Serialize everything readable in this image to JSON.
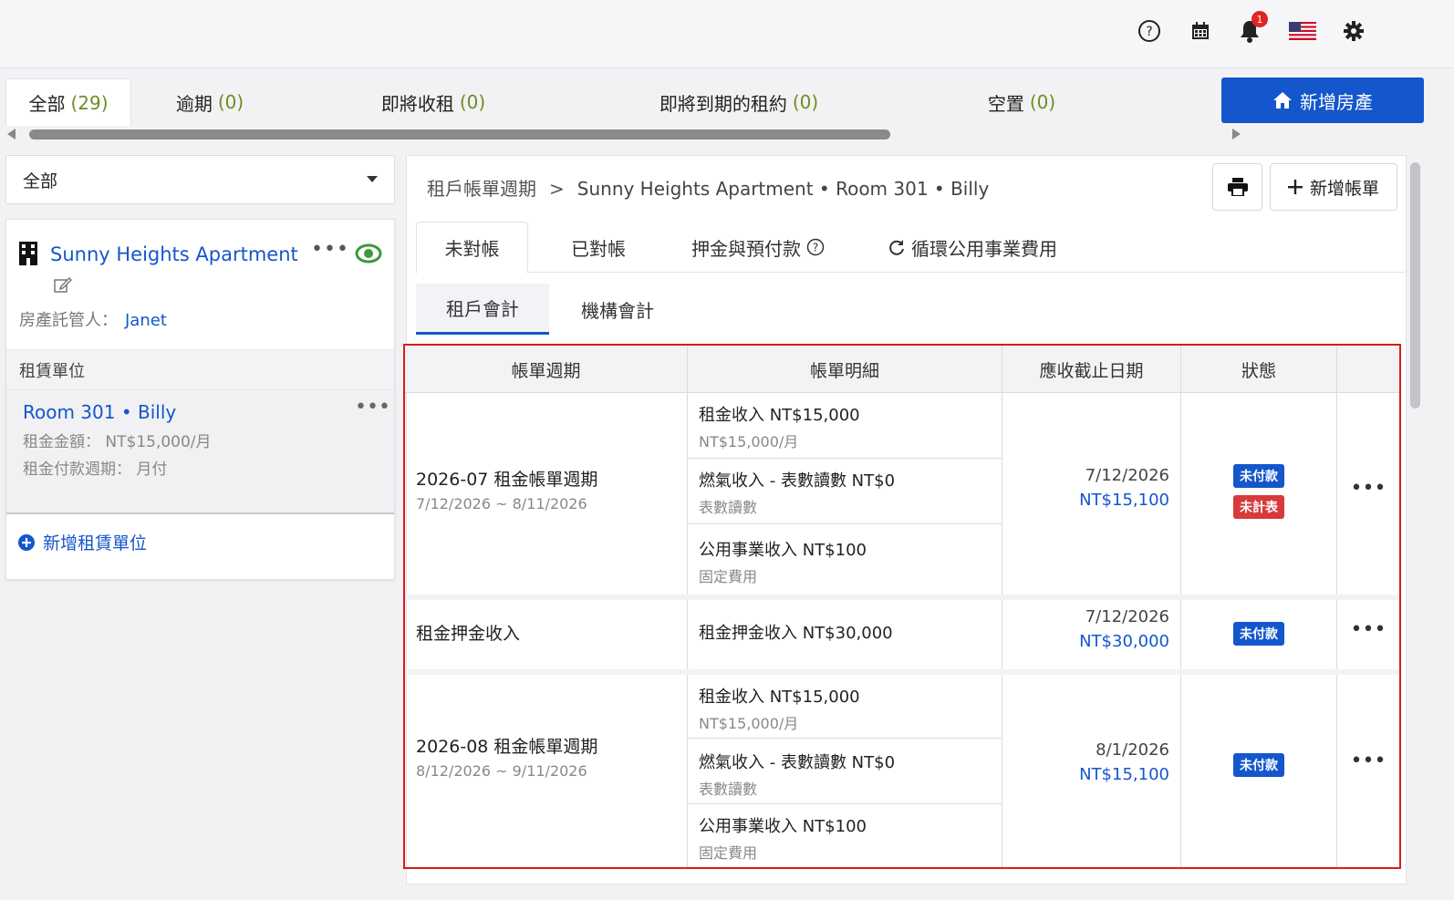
{
  "topbar": {
    "icons": [
      "help-icon",
      "calendar-icon",
      "bell-icon",
      "us-flag-icon",
      "gear-icon"
    ],
    "notification_count": "1"
  },
  "filter_tabs": [
    {
      "label": "全部",
      "count": "(29)"
    },
    {
      "label": "逾期",
      "count": "(0)"
    },
    {
      "label": "即將收租",
      "count": "(0)"
    },
    {
      "label": "即將到期的租約",
      "count": "(0)"
    },
    {
      "label": "空置",
      "count": "(0)"
    }
  ],
  "add_property_label": "新增房產",
  "sidebar": {
    "select_value": "全部",
    "property": {
      "name": "Sunny Heights Apartment",
      "more": "•••",
      "manager_label": "房產託管人：",
      "manager_name": "Janet"
    },
    "units_header": "租賃單位",
    "unit": {
      "title": "Room 301 • Billy",
      "more": "•••",
      "rent_line": "租金金額： NT$15,000/月",
      "cycle_line": "租金付款週期： 月付"
    },
    "add_unit_label": "新增租賃單位"
  },
  "main": {
    "breadcrumb_root": "租戶帳單週期",
    "breadcrumb_sep": ">",
    "breadcrumb_current": "Sunny Heights Apartment • Room 301 • Billy",
    "add_bill_label": "新增帳單",
    "tabs": [
      {
        "label": "未對帳"
      },
      {
        "label": "已對帳"
      },
      {
        "label": "押金與預付款"
      },
      {
        "label": "循環公用事業費用"
      }
    ],
    "subtabs": [
      {
        "label": "租戶會計"
      },
      {
        "label": "機構會計"
      }
    ],
    "table": {
      "headers": [
        "帳單週期",
        "帳單明細",
        "應收截止日期",
        "狀態",
        ""
      ],
      "groups": [
        {
          "period_title": "2026-07 租金帳單週期",
          "period_range": "7/12/2026 ~ 8/11/2026",
          "details": [
            {
              "line1": "租金收入  NT$15,000",
              "line2": "NT$15,000/月"
            },
            {
              "line1": "燃氣收入 - 表數讀數  NT$0",
              "line2": "表數讀數"
            },
            {
              "line1": "公用事業收入  NT$100",
              "line2": "固定費用"
            }
          ],
          "due_date": "7/12/2026",
          "amount": "NT$15,100",
          "statuses": [
            {
              "label": "未付款",
              "color": "blue"
            },
            {
              "label": "未計表",
              "color": "red"
            }
          ],
          "more": "•••"
        },
        {
          "period_title": "租金押金收入",
          "period_range": "",
          "details": [
            {
              "line1": "租金押金收入  NT$30,000",
              "line2": ""
            }
          ],
          "due_date": "7/12/2026",
          "amount": "NT$30,000",
          "statuses": [
            {
              "label": "未付款",
              "color": "blue"
            }
          ],
          "more": "•••"
        },
        {
          "period_title": "2026-08 租金帳單週期",
          "period_range": "8/12/2026 ~ 9/11/2026",
          "details": [
            {
              "line1": "租金收入  NT$15,000",
              "line2": "NT$15,000/月"
            },
            {
              "line1": "燃氣收入 - 表數讀數  NT$0",
              "line2": "表數讀數"
            },
            {
              "line1": "公用事業收入  NT$100",
              "line2": "固定費用"
            }
          ],
          "due_date": "8/1/2026",
          "amount": "NT$15,100",
          "statuses": [
            {
              "label": "未付款",
              "color": "blue"
            }
          ],
          "more": "•••"
        }
      ]
    }
  },
  "colors": {
    "primary": "#1456cc",
    "count_green": "#6b8e23",
    "highlight_border": "#d91b1b",
    "status_red": "#d63a3a"
  }
}
